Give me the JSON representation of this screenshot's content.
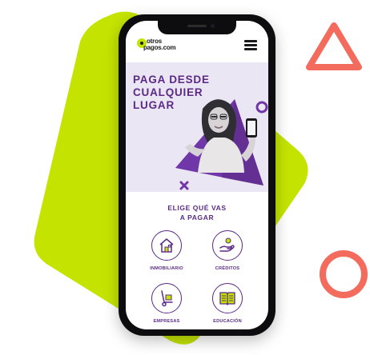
{
  "brand": {
    "logo_line1": "otros",
    "logo_line2": "pagos.com",
    "accent_color": "#c4e400",
    "primary_color": "#5b2a86"
  },
  "header": {
    "menu_icon": "hamburger-menu-icon"
  },
  "hero": {
    "title_line1": "PAGA DESDE",
    "title_line2": "CUALQUIER",
    "title_line3": "LUGAR"
  },
  "section": {
    "title_line1": "ELIGE QUÉ VAS",
    "title_line2": "A PAGAR"
  },
  "categories": [
    {
      "label": "INMOBILIARIO",
      "icon": "house-icon"
    },
    {
      "label": "CRÉDITOS",
      "icon": "hand-coin-icon"
    },
    {
      "label": "EMPRESAS",
      "icon": "hand-truck-icon"
    },
    {
      "label": "EDUCACIÓN",
      "icon": "open-book-icon"
    }
  ],
  "decorations": {
    "blob_color": "#c4e400",
    "triangle_color": "#f36b5c",
    "ring_color": "#f36b5c"
  }
}
